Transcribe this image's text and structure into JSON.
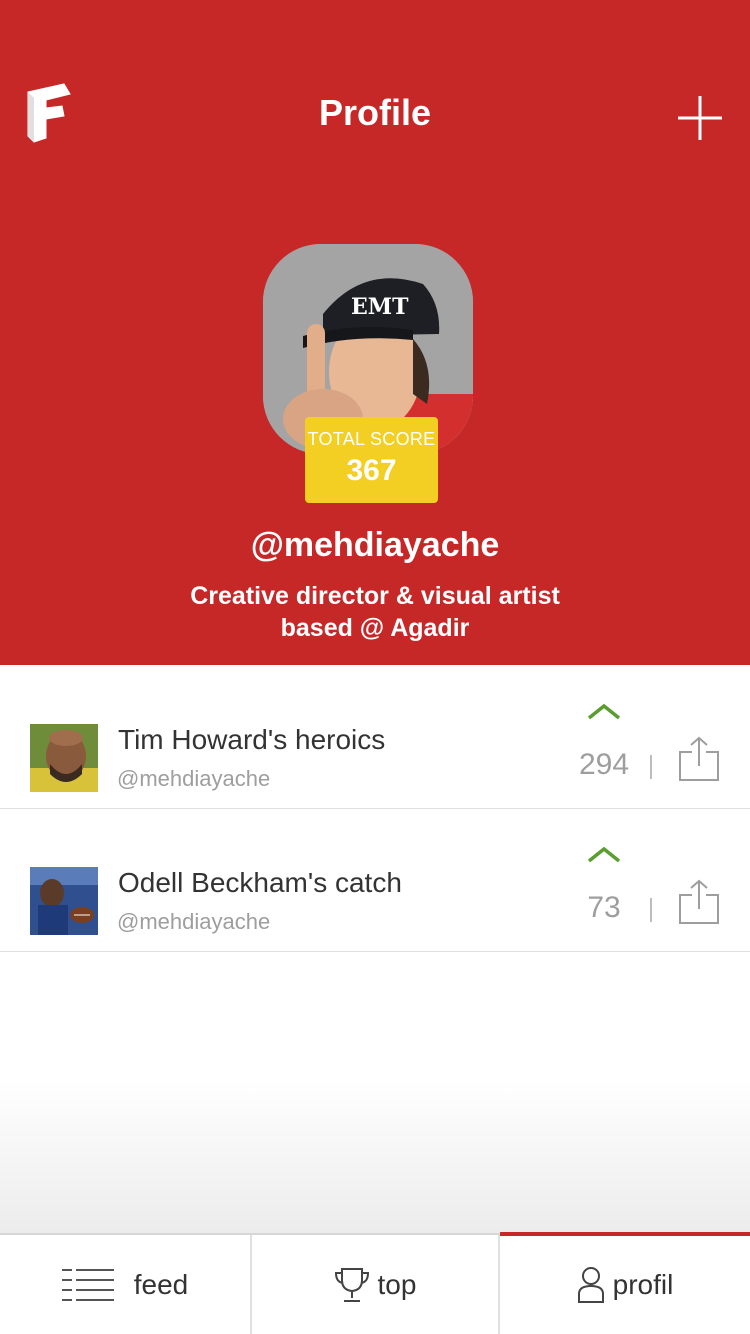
{
  "header": {
    "title": "Profile",
    "logo_icon": "app-logo-f",
    "add_icon": "plus-icon",
    "background_color": "#c62828"
  },
  "profile": {
    "avatar_icon": "user-avatar-photo",
    "score_label": "TOTAL SCORE",
    "score_value": "367",
    "username": "@mehdiayache",
    "bio_line1": "Creative director & visual artist",
    "bio_line2": "based @ Agadir"
  },
  "posts": [
    {
      "title": "Tim Howard's heroics",
      "user": "@mehdiayache",
      "votes": "294",
      "thumb_icon": "soccer-goalkeeper-photo"
    },
    {
      "title": "Odell Beckham's catch",
      "user": "@mehdiayache",
      "votes": "73",
      "thumb_icon": "football-catch-photo"
    }
  ],
  "tabs": [
    {
      "label": "feed",
      "icon": "list-icon",
      "active": false
    },
    {
      "label": "top",
      "icon": "trophy-icon",
      "active": false
    },
    {
      "label": "profil",
      "icon": "user-icon",
      "active": true
    }
  ],
  "colors": {
    "accent": "#c62828",
    "score_badge": "#f2cf22",
    "upvote": "#5a9e2f"
  }
}
